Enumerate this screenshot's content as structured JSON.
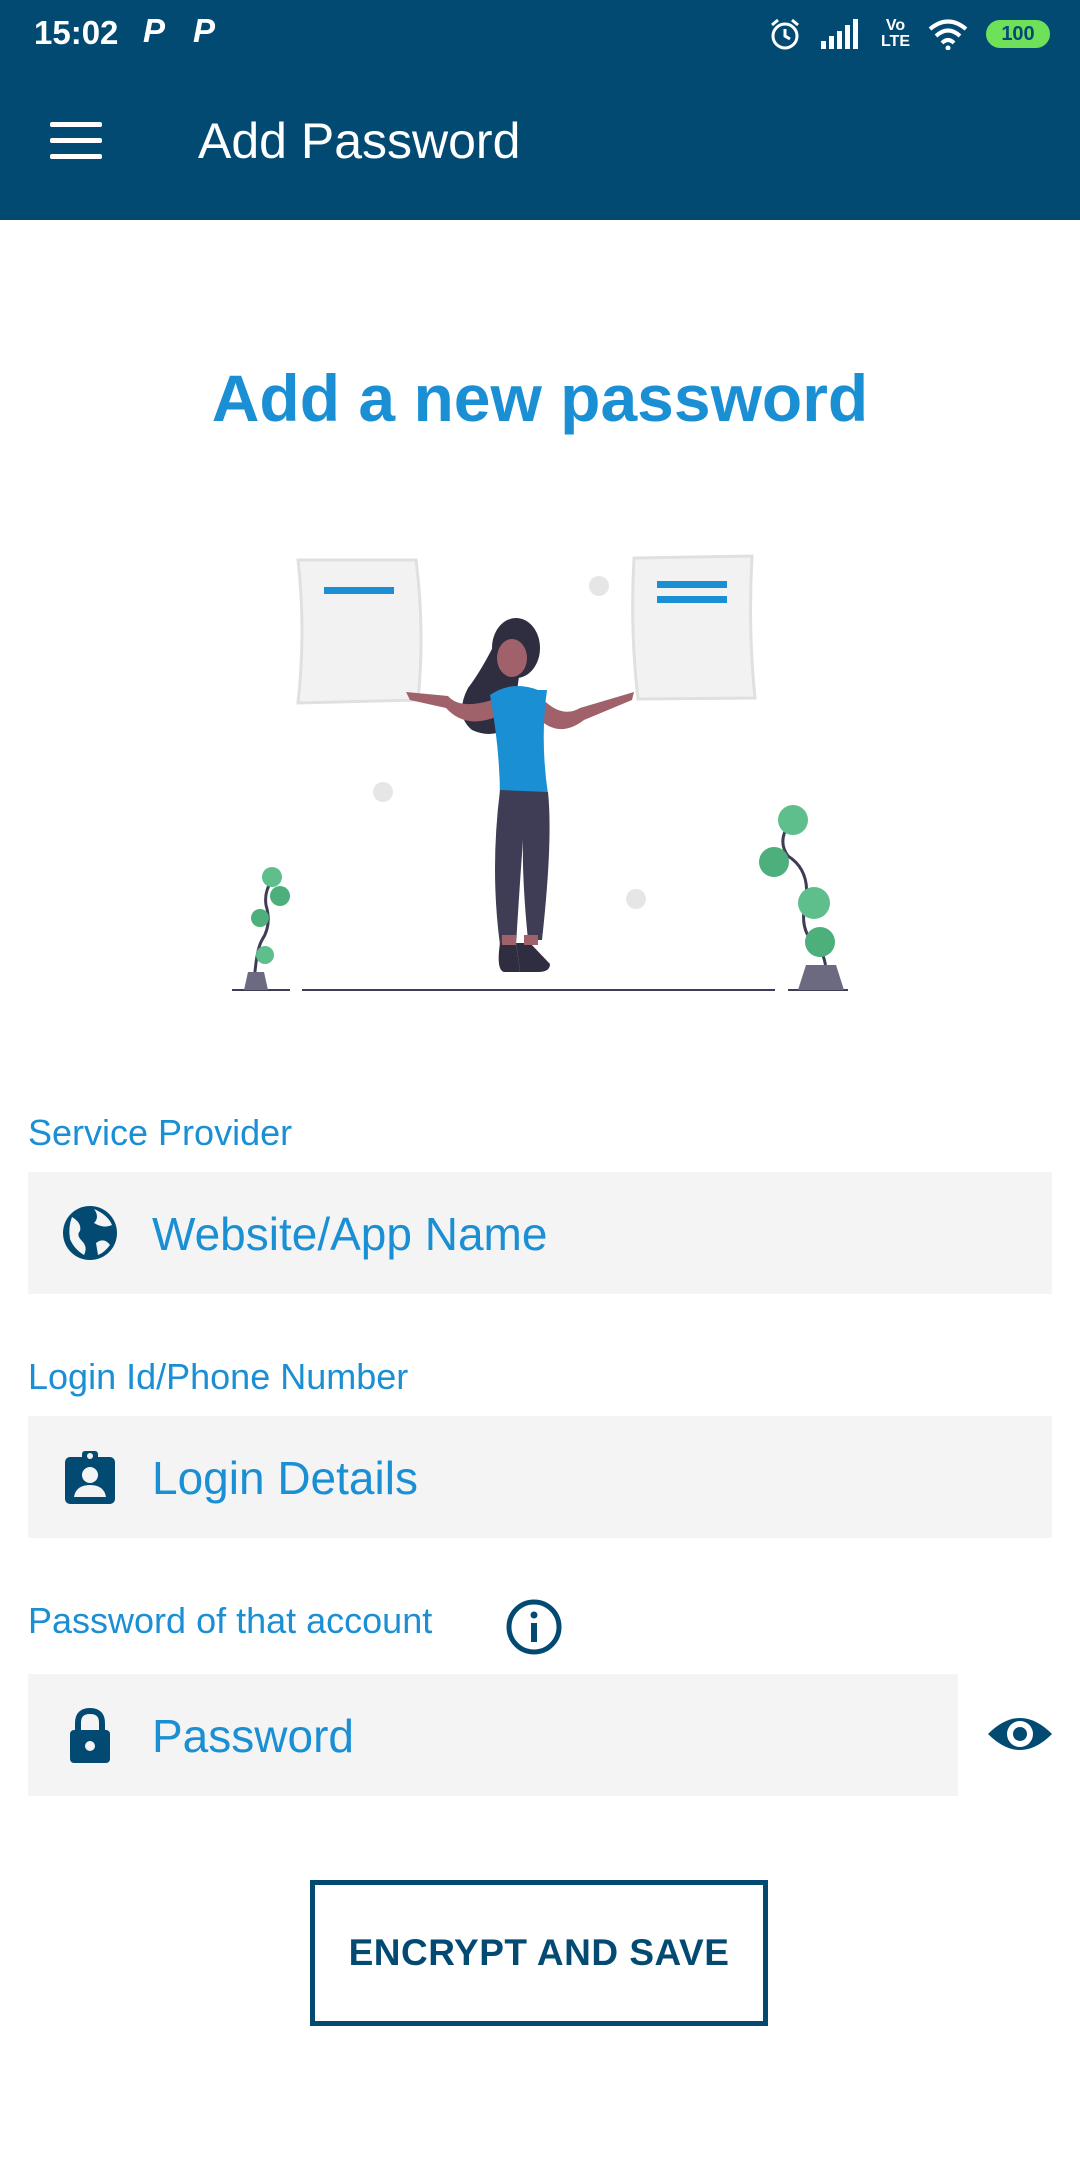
{
  "status_bar": {
    "time": "15:02",
    "notification_1": "P",
    "notification_2": "P",
    "network_label_top": "Vo",
    "network_label_bottom": "LTE",
    "battery": "100",
    "icons": [
      "alarm-icon",
      "signal-icon",
      "volte-icon",
      "wifi-icon",
      "battery-icon"
    ]
  },
  "app_bar": {
    "title": "Add Password",
    "menu_icon": "hamburger-menu-icon"
  },
  "main": {
    "headline": "Add a new password",
    "illustration": "woman-holding-password-cards-illustration"
  },
  "form": {
    "service_provider": {
      "label": "Service Provider",
      "placeholder": "Website/App Name",
      "value": "",
      "icon": "globe-icon"
    },
    "login": {
      "label": "Login Id/Phone Number",
      "placeholder": "Login Details",
      "value": "",
      "icon": "contact-badge-icon"
    },
    "password": {
      "label": "Password of that account",
      "placeholder": "Password",
      "value": "",
      "icon": "lock-icon",
      "info_icon": "info-icon",
      "visibility_icon": "eye-icon"
    },
    "submit_label": "ENCRYPT AND SAVE"
  },
  "colors": {
    "primary_dark": "#034a73",
    "accent_blue": "#1b8fd4",
    "field_bg": "#f4f4f4",
    "battery_green": "#6ee05a"
  }
}
